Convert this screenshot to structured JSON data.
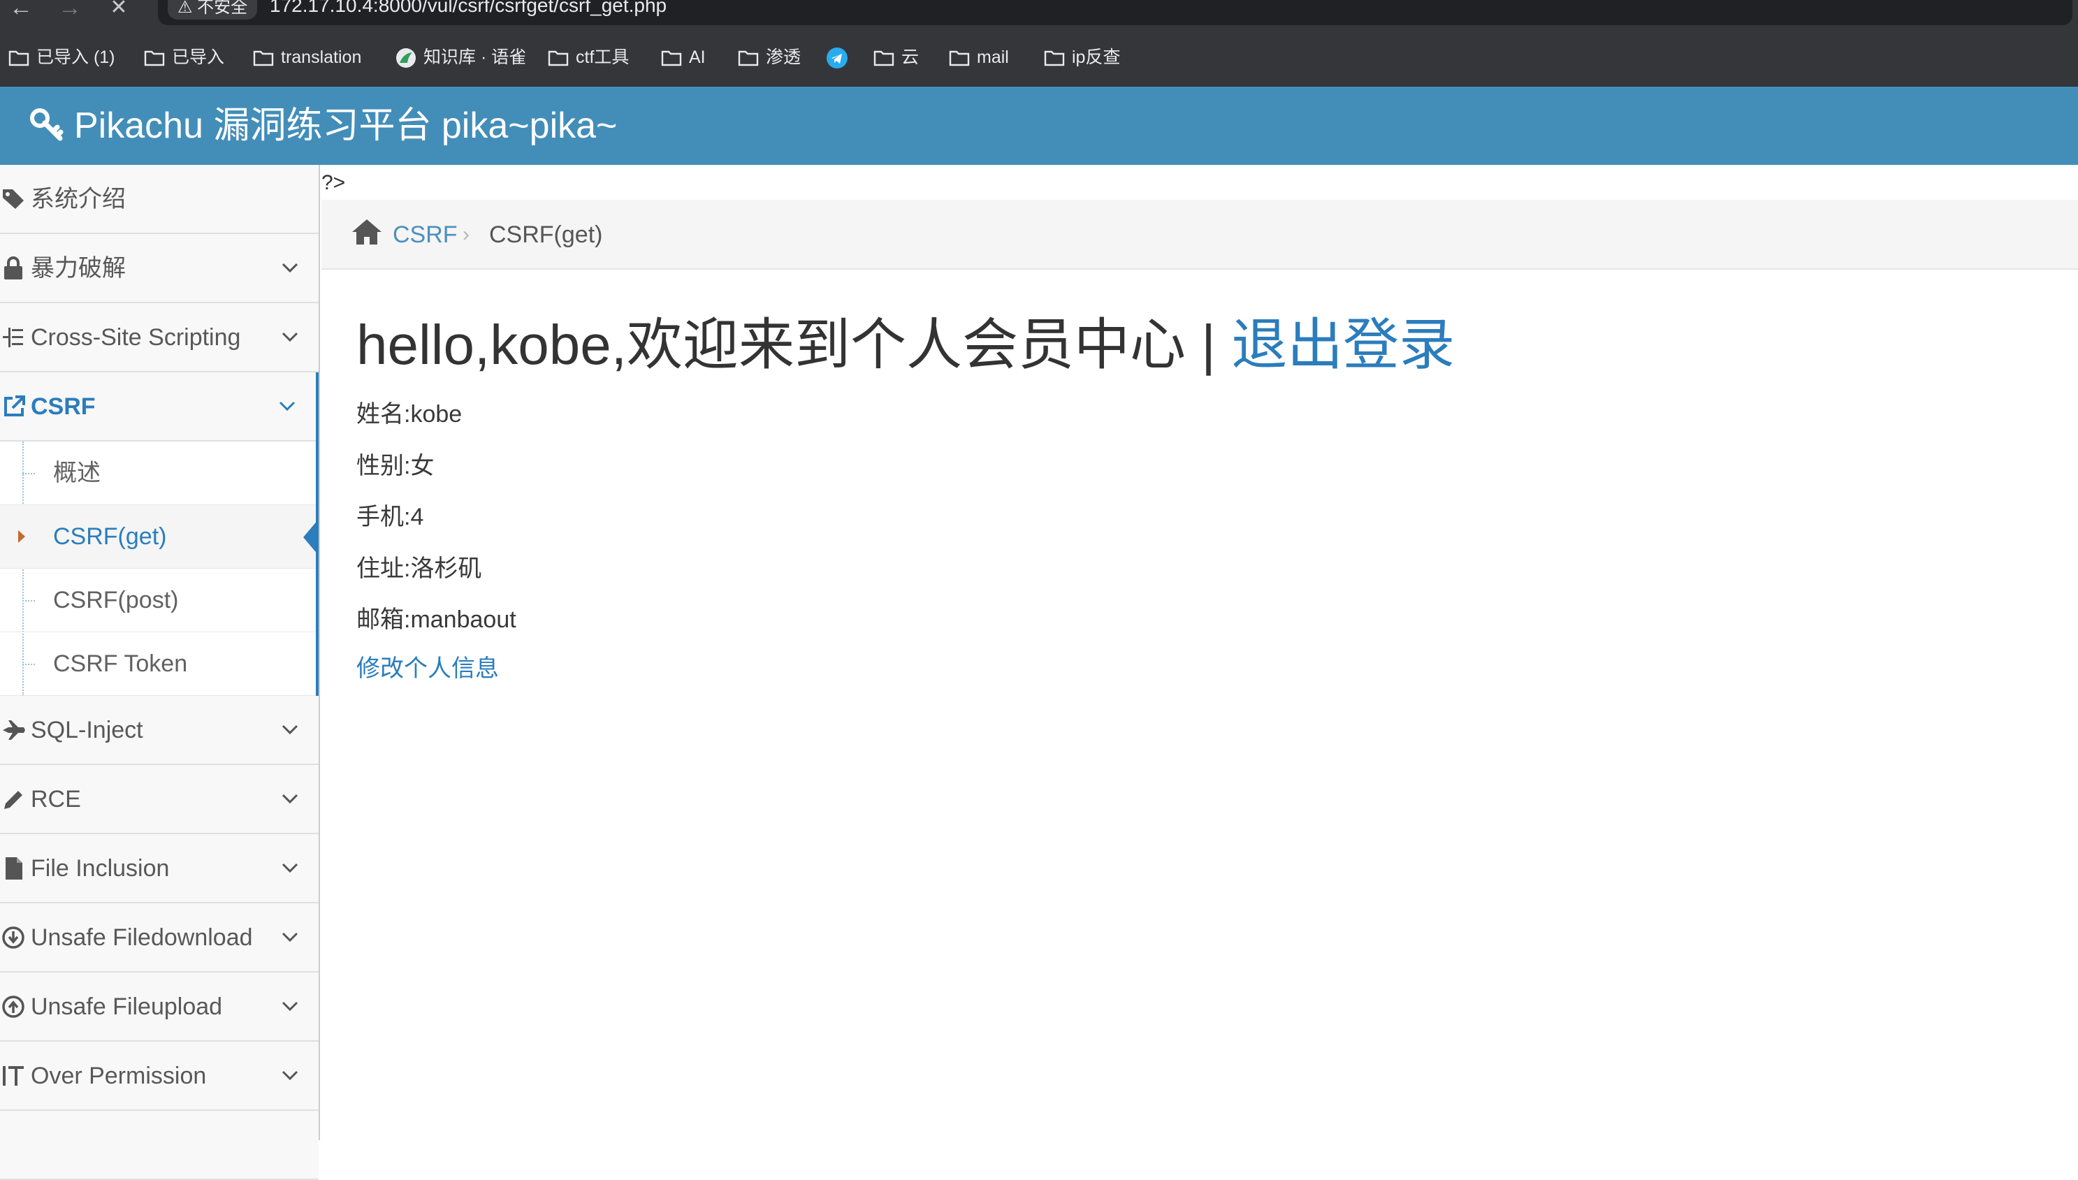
{
  "browser": {
    "security_label": "⚠ 不安全",
    "url": "172.17.10.4:8000/vul/csrf/csrfget/csrf_get.php",
    "bookmarks": [
      "已导入 (1)",
      "已导入",
      "translation",
      "知识库 · 语雀",
      "ctf工具",
      "AI",
      "渗透",
      "云",
      "mail",
      "ip反查"
    ]
  },
  "header": {
    "title": "Pikachu 漏洞练习平台 pika~pika~"
  },
  "sidebar": {
    "items": [
      {
        "label": "系统介绍"
      },
      {
        "label": "暴力破解"
      },
      {
        "label": "Cross-Site Scripting"
      },
      {
        "label": "CSRF"
      },
      {
        "label": "SQL-Inject"
      },
      {
        "label": "RCE"
      },
      {
        "label": "File Inclusion"
      },
      {
        "label": "Unsafe Filedownload"
      },
      {
        "label": "Unsafe Fileupload"
      },
      {
        "label": "Over Permission"
      }
    ],
    "csrf_sub": [
      "概述",
      "CSRF(get)",
      "CSRF(post)",
      "CSRF Token"
    ]
  },
  "main": {
    "php_remnant": "?>",
    "breadcrumb": {
      "section": "CSRF",
      "separator": "›",
      "current": "CSRF(get)"
    },
    "greeting": "hello,kobe,欢迎来到个人会员中心 | ",
    "logout": "退出登录",
    "info": {
      "name": "姓名:kobe",
      "gender": "性别:女",
      "phone": "手机:4",
      "address": "住址:洛杉矶",
      "email": "邮箱:manbaout"
    },
    "edit_link": "修改个人信息"
  },
  "colors": {
    "header_bg": "#438eb9",
    "link": "#2b7dbc",
    "sidebar_bg": "#f2f2f2"
  }
}
